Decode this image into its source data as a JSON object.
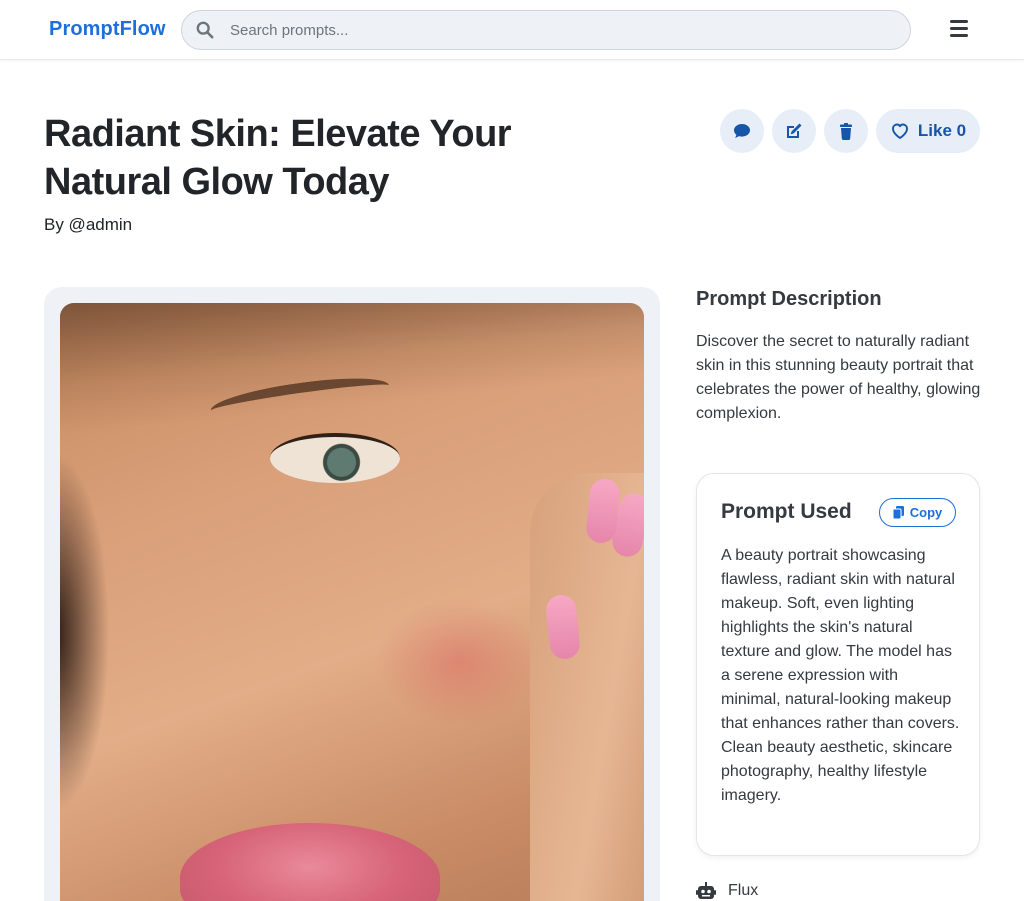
{
  "header": {
    "logo": "PromptFlow",
    "search_placeholder": "Search prompts..."
  },
  "post": {
    "title": "Radiant Skin: Elevate Your Natural Glow Today",
    "byline": "By @admin",
    "like_label": "Like 0",
    "likes": 0
  },
  "description": {
    "heading": "Prompt Description",
    "text": "Discover the secret to naturally radiant skin in this stunning beauty portrait that celebrates the power of healthy, glowing complexion."
  },
  "prompt": {
    "heading": "Prompt Used",
    "copy_label": "Copy",
    "text": "A beauty portrait showcasing flawless, radiant skin with natural makeup. Soft, even lighting highlights the skin's natural texture and glow. The model has a serene expression with minimal, natural-looking makeup that enhances rather than covers. Clean beauty aesthetic, skincare photography, healthy lifestyle imagery."
  },
  "model": {
    "name": "Flux",
    "icon": "robot-icon"
  },
  "colors": {
    "brand": "#1e6fd9",
    "button_bg": "#e8eef7",
    "button_icon": "#1655a8"
  }
}
